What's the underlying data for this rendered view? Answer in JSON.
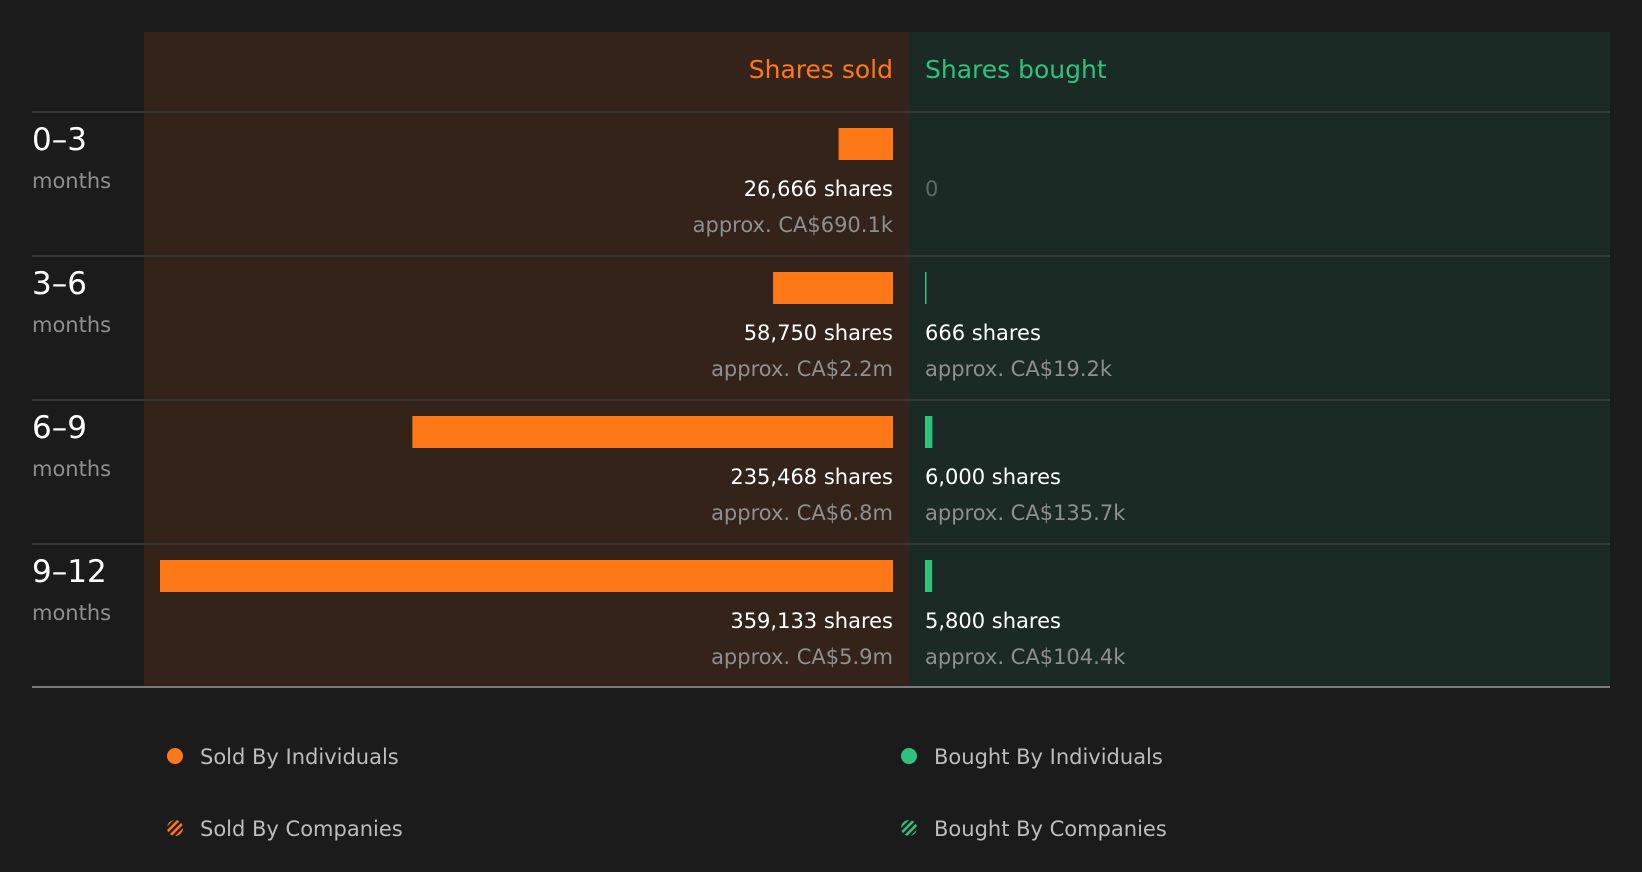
{
  "chart_data": {
    "type": "bar",
    "headers": {
      "sold": "Shares sold",
      "bought": "Shares bought"
    },
    "periods": [
      {
        "range": "0–3",
        "unit": "months",
        "sold": {
          "shares": 26666,
          "shares_label": "26,666 shares",
          "value_label": "approx. CA$690.1k"
        },
        "bought": {
          "shares": 0,
          "shares_label": "0",
          "value_label": ""
        }
      },
      {
        "range": "3–6",
        "unit": "months",
        "sold": {
          "shares": 58750,
          "shares_label": "58,750 shares",
          "value_label": "approx. CA$2.2m"
        },
        "bought": {
          "shares": 666,
          "shares_label": "666 shares",
          "value_label": "approx. CA$19.2k"
        }
      },
      {
        "range": "6–9",
        "unit": "months",
        "sold": {
          "shares": 235468,
          "shares_label": "235,468 shares",
          "value_label": "approx. CA$6.8m"
        },
        "bought": {
          "shares": 6000,
          "shares_label": "6,000 shares",
          "value_label": "approx. CA$135.7k"
        }
      },
      {
        "range": "9–12",
        "unit": "months",
        "sold": {
          "shares": 359133,
          "shares_label": "359,133 shares",
          "value_label": "approx. CA$5.9m"
        },
        "bought": {
          "shares": 5800,
          "shares_label": "5,800 shares",
          "value_label": "approx. CA$104.4k"
        }
      }
    ],
    "max_shares": 359133,
    "legend": [
      {
        "label": "Sold By Individuals",
        "icon": "dot",
        "color": "#ff7818"
      },
      {
        "label": "Bought By Individuals",
        "icon": "dot",
        "color": "#2ec27e"
      },
      {
        "label": "Sold By Companies",
        "icon": "striped-dot",
        "color": "#ff7818"
      },
      {
        "label": "Bought By Companies",
        "icon": "striped-dot",
        "color": "#2ec27e"
      }
    ],
    "colors": {
      "background": "#1b1b1b",
      "sold_panel": "#33231b",
      "bought_panel": "#1b2a24",
      "sold": "#ff7818",
      "bought": "#2ec27e",
      "text": "#ffffff",
      "muted": "#8f8f8f"
    }
  }
}
